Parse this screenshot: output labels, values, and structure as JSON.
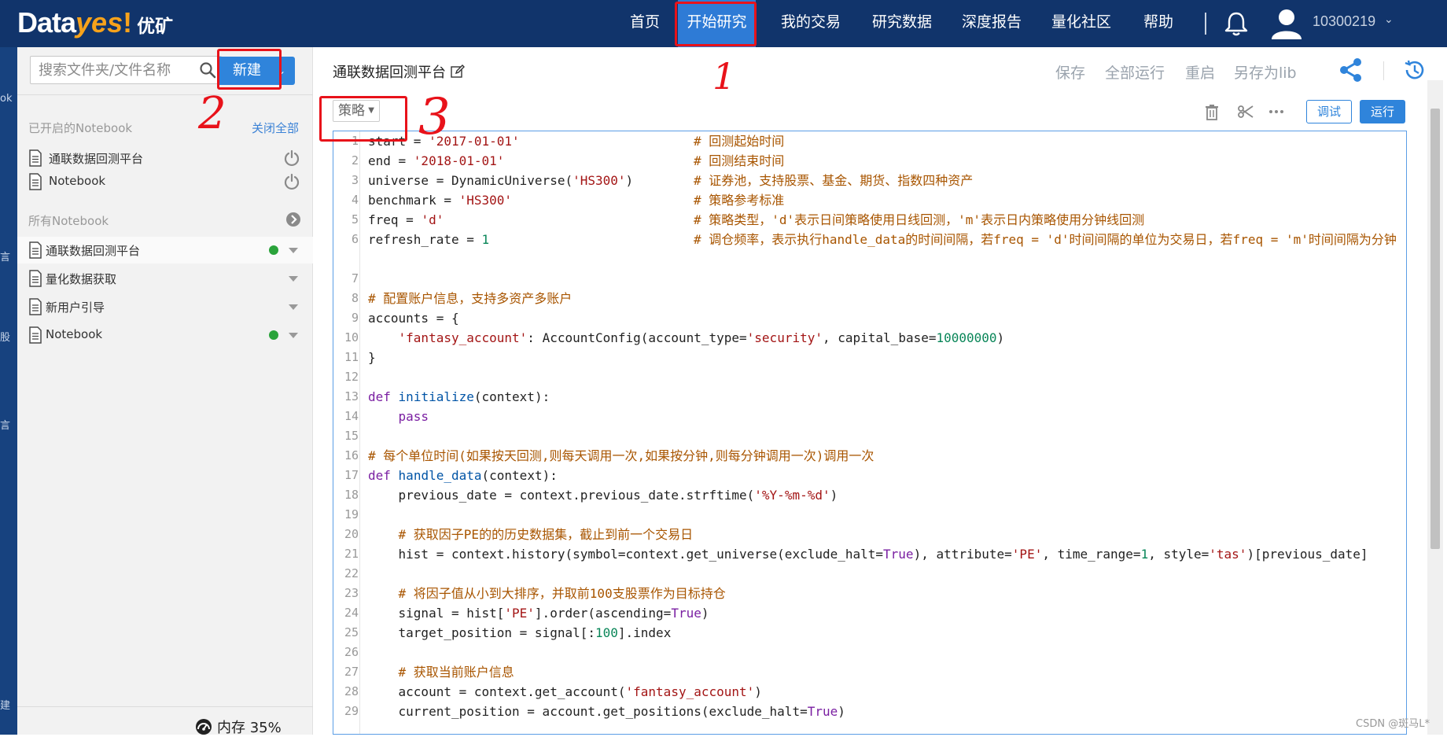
{
  "topbar": {
    "logo_data": "Data",
    "logo_yes": "yes",
    "logo_excl": "!",
    "logo_cn": "优矿",
    "nav": [
      {
        "label": "首页"
      },
      {
        "label": "开始研究",
        "active": true
      },
      {
        "label": "我的交易"
      },
      {
        "label": "研究数据"
      },
      {
        "label": "深度报告"
      },
      {
        "label": "量化社区"
      },
      {
        "label": "帮助"
      }
    ],
    "user_id": "10300219",
    "user_chevron": "⌄"
  },
  "leftstrip": {
    "chars": [
      "ok",
      "言",
      "股",
      "言",
      "建"
    ]
  },
  "sidebar": {
    "search_placeholder": "搜索文件夹/文件名称",
    "new_button": "新建",
    "open_section_title": "已开启的Notebook",
    "close_all": "关闭全部",
    "open_items": [
      {
        "label": "通联数据回测平台"
      },
      {
        "label": "Notebook"
      }
    ],
    "all_section_title": "所有Notebook",
    "all_items": [
      {
        "label": "通联数据回测平台",
        "running": true
      },
      {
        "label": "量化数据获取",
        "running": false
      },
      {
        "label": "新用户引导",
        "running": false
      },
      {
        "label": "Notebook",
        "running": true
      }
    ],
    "memory": "内存 35%"
  },
  "main": {
    "title": "通联数据回测平台",
    "actions": {
      "save": "保存",
      "run_all": "全部运行",
      "restart": "重启",
      "save_as": "另存为lib"
    },
    "strategy_select": "策略",
    "debug_button": "调试",
    "run_button": "运行"
  },
  "colors": {
    "topbar": "#11346b",
    "nav_active": "#2e7bd6",
    "accent": "#2f84db",
    "string": "#a31515",
    "number": "#098658",
    "keyword": "#7a1fa2",
    "function": "#0054a6",
    "comment": "#a85500",
    "annotation": "#e8121a"
  },
  "editor": {
    "lines": [
      {
        "n": "1",
        "code": "start = '2017-01-01'",
        "comment": "# 回测起始时间"
      },
      {
        "n": "2",
        "code": "end = '2018-01-01'",
        "comment": "# 回测结束时间"
      },
      {
        "n": "3",
        "code": "universe = DynamicUniverse('HS300')",
        "comment": "# 证券池，支持股票、基金、期货、指数四种资产"
      },
      {
        "n": "4",
        "code": "benchmark = 'HS300'",
        "comment": "# 策略参考标准"
      },
      {
        "n": "5",
        "code": "freq = 'd'",
        "comment": "# 策略类型，'d'表示日间策略使用日线回测，'m'表示日内策略使用分钟线回测"
      },
      {
        "n": "6",
        "code": "refresh_rate = 1",
        "comment": "# 调仓频率，表示执行handle_data的时间间隔，若freq = 'd'时间间隔的单位为交易日，若freq = 'm'时间间隔为分钟"
      },
      {
        "n": "7",
        "code": ""
      },
      {
        "n": "8",
        "code": "# 配置账户信息，支持多资产多账户"
      },
      {
        "n": "9",
        "code": "accounts = {"
      },
      {
        "n": "10",
        "code": "    'fantasy_account': AccountConfig(account_type='security', capital_base=10000000)"
      },
      {
        "n": "11",
        "code": "}"
      },
      {
        "n": "12",
        "code": ""
      },
      {
        "n": "13",
        "code": "def initialize(context):"
      },
      {
        "n": "14",
        "code": "    pass"
      },
      {
        "n": "15",
        "code": ""
      },
      {
        "n": "16",
        "code": "# 每个单位时间(如果按天回测,则每天调用一次,如果按分钟,则每分钟调用一次)调用一次"
      },
      {
        "n": "17",
        "code": "def handle_data(context):"
      },
      {
        "n": "18",
        "code": "    previous_date = context.previous_date.strftime('%Y-%m-%d')"
      },
      {
        "n": "19",
        "code": ""
      },
      {
        "n": "20",
        "code": "    # 获取因子PE的的历史数据集，截止到前一个交易日"
      },
      {
        "n": "21",
        "code": "    hist = context.history(symbol=context.get_universe(exclude_halt=True), attribute='PE', time_range=1, style='tas')[previous_date]"
      },
      {
        "n": "22",
        "code": ""
      },
      {
        "n": "23",
        "code": "    # 将因子值从小到大排序，并取前100支股票作为目标持仓"
      },
      {
        "n": "24",
        "code": "    signal = hist['PE'].order(ascending=True)"
      },
      {
        "n": "25",
        "code": "    target_position = signal[:100].index"
      },
      {
        "n": "26",
        "code": ""
      },
      {
        "n": "27",
        "code": "    # 获取当前账户信息"
      },
      {
        "n": "28",
        "code": "    account = context.get_account('fantasy_account')"
      },
      {
        "n": "29",
        "code": "    current_position = account.get_positions(exclude_halt=True)"
      }
    ]
  },
  "annotations": [
    "1",
    "2",
    "3"
  ],
  "watermark": "CSDN @斑马L*"
}
